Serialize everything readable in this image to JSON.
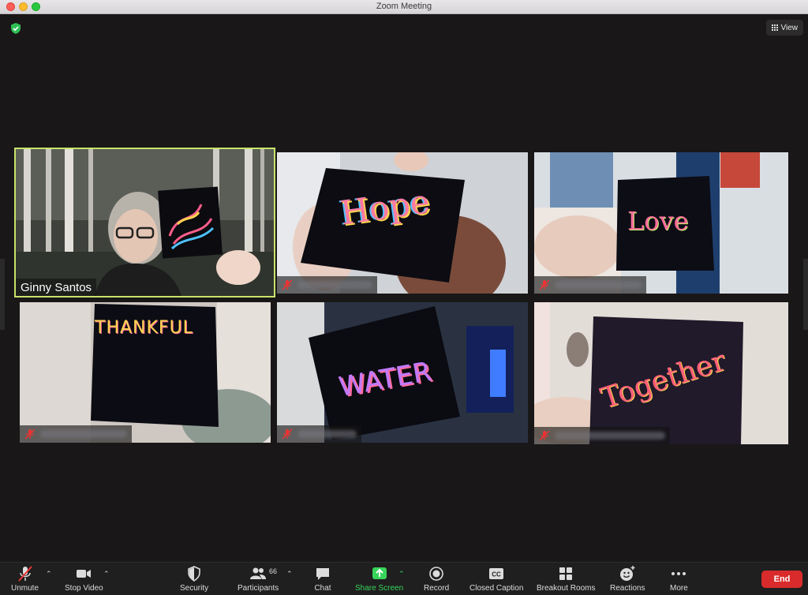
{
  "window": {
    "title": "Zoom Meeting"
  },
  "header": {
    "view_label": "View"
  },
  "tiles": [
    {
      "name": "Ginny Santos",
      "card_text": "",
      "active": true,
      "muted": false
    },
    {
      "name": "",
      "card_text": "Hope",
      "active": false,
      "muted": true
    },
    {
      "name": "",
      "card_text": "Love",
      "active": false,
      "muted": true
    },
    {
      "name": "",
      "card_text": "THANKFUL",
      "active": false,
      "muted": true
    },
    {
      "name": "",
      "card_text": "WATER",
      "active": false,
      "muted": true
    },
    {
      "name": "",
      "card_text": "Together",
      "active": false,
      "muted": true
    }
  ],
  "toolbar": {
    "unmute": "Unmute",
    "stop_video": "Stop Video",
    "security": "Security",
    "participants": "Participants",
    "participants_count": "66",
    "chat": "Chat",
    "share_screen": "Share Screen",
    "record": "Record",
    "closed_caption": "Closed Caption",
    "breakout_rooms": "Breakout Rooms",
    "reactions": "Reactions",
    "more": "More",
    "end": "End"
  },
  "colors": {
    "active_outline": "#c8e26b",
    "share_green": "#37d55a",
    "end_red": "#d92b2b"
  }
}
